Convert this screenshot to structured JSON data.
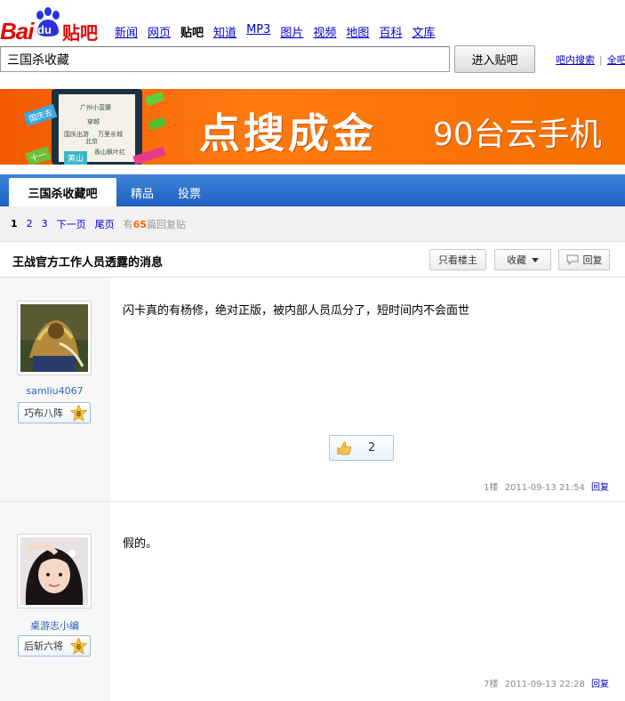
{
  "header": {
    "logo_bai": "Bai",
    "logo_du": "du",
    "logo_tieba": "贴吧",
    "nav": [
      {
        "label": "新闻",
        "current": false
      },
      {
        "label": "网页",
        "current": false
      },
      {
        "label": "贴吧",
        "current": true
      },
      {
        "label": "知道",
        "current": false
      },
      {
        "label": "MP3",
        "current": false
      },
      {
        "label": "图片",
        "current": false
      },
      {
        "label": "视频",
        "current": false
      },
      {
        "label": "地图",
        "current": false
      },
      {
        "label": "百科",
        "current": false
      },
      {
        "label": "文库",
        "current": false
      }
    ],
    "search_value": "三国杀收藏",
    "search_button": "进入贴吧",
    "link_inner_search": "吧内搜索",
    "link_separator": "|",
    "link_all": "全吧"
  },
  "banner": {
    "headline": "点搜成金",
    "sub": "90台云手机",
    "tags": [
      "国庆去",
      "十一",
      "黄山",
      "广州小蛮腰",
      "穿越",
      "国庆出游",
      "万里长城",
      "香山枫叶红",
      "北京"
    ]
  },
  "tabs": [
    {
      "label": "三国杀收藏吧",
      "active": true
    },
    {
      "label": "精品",
      "active": false
    },
    {
      "label": "投票",
      "active": false
    }
  ],
  "pager": {
    "current": "1",
    "pages": [
      "2",
      "3"
    ],
    "next": "下一页",
    "last": "尾页",
    "total_prefix": "有",
    "total_count": "65",
    "total_suffix": "篇回复贴"
  },
  "thread": {
    "title": "王战官方工作人员透露的消息",
    "btn_only_op": "只看楼主",
    "btn_favorite": "收藏",
    "btn_reply": "回复"
  },
  "posts": [
    {
      "username": "samliu4067",
      "badge": "巧布八阵",
      "level": "8",
      "content": "闪卡真的有杨修，绝对正版，被内部人员瓜分了，短时间内不会面世",
      "likes": "2",
      "floor": "1楼",
      "time": "2011-09-13 21:54",
      "reply": "回复"
    },
    {
      "username": "桌游志小编",
      "badge": "后斩六将",
      "level": "6",
      "content": "假的。",
      "floor": "7楼",
      "time": "2011-09-13 22:28",
      "reply": "回复"
    }
  ],
  "colors": {
    "brand_red": "#e10602",
    "tab_blue": "#2a6fcf",
    "banner_orange": "#f56a00",
    "link_blue": "#0000cc"
  }
}
